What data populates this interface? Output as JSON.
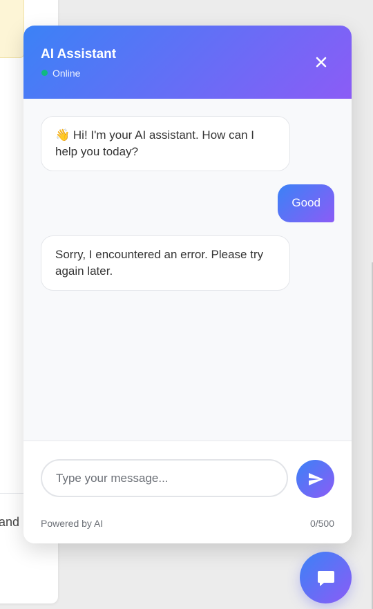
{
  "background": {
    "partial_text": "and"
  },
  "header": {
    "title": "AI Assistant",
    "status": "Online",
    "status_color": "#10b981",
    "close_icon": "close-icon"
  },
  "messages": [
    {
      "sender": "bot",
      "text": "👋 Hi! I'm your AI assistant. How can I help you today?"
    },
    {
      "sender": "user",
      "text": "Good"
    },
    {
      "sender": "bot",
      "text": "Sorry, I encountered an error. Please try again later."
    }
  ],
  "input": {
    "placeholder": "Type your message...",
    "value": ""
  },
  "footer": {
    "powered_by": "Powered by AI",
    "char_count": "0/500"
  },
  "colors": {
    "gradient_start": "#3b82f6",
    "gradient_end": "#8b5cf6"
  },
  "icons": {
    "send": "send-icon",
    "launcher": "chat-icon"
  }
}
